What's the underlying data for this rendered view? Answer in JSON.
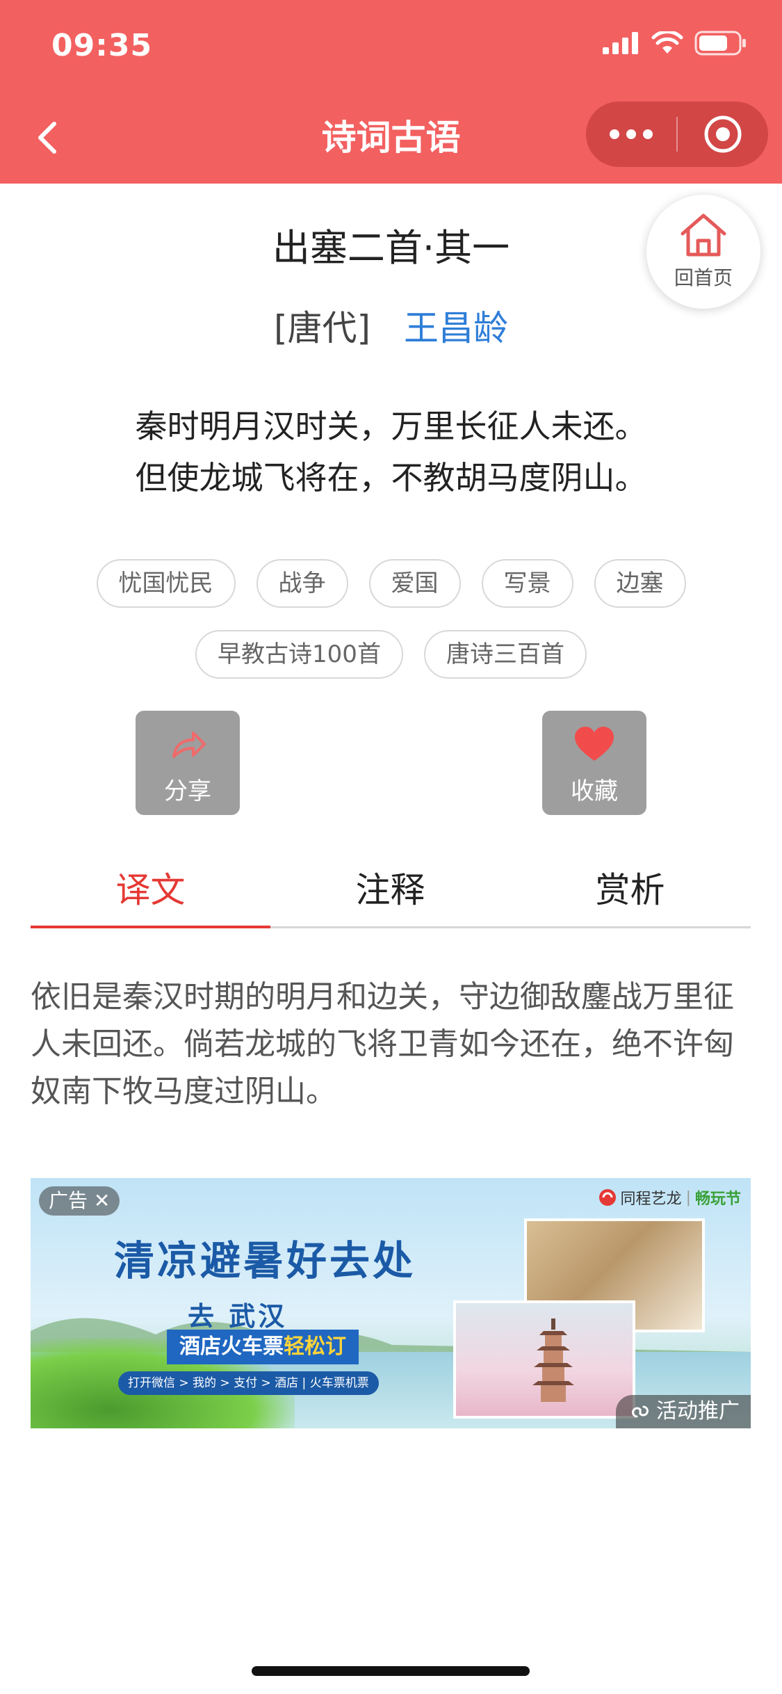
{
  "status_bar": {
    "time": "09:35"
  },
  "nav": {
    "title": "诗词古语"
  },
  "home_button": {
    "label": "回首页"
  },
  "poem": {
    "title": "出塞二首·其一",
    "dynasty": "[唐代]",
    "author": "王昌龄",
    "lines": [
      "秦时明月汉时关，万里长征人未还。",
      "但使龙城飞将在，不教胡马度阴山。"
    ]
  },
  "tags": {
    "row1": [
      "忧国忧民",
      "战争",
      "爱国",
      "写景",
      "边塞"
    ],
    "row2": [
      "早教古诗100首",
      "唐诗三百首"
    ]
  },
  "actions": {
    "share_label": "分享",
    "favorite_label": "收藏"
  },
  "tabs": [
    {
      "label": "译文",
      "active": true
    },
    {
      "label": "注释",
      "active": false
    },
    {
      "label": "赏析",
      "active": false
    }
  ],
  "translation": "依旧是秦汉时期的明月和边关，守边御敌鏖战万里征人未回还。倘若龙城的飞将卫青如今还在，绝不许匈奴南下牧马度过阴山。",
  "ad": {
    "badge": "广告",
    "brand": "同程艺龙",
    "brand_slogan": "畅玩节",
    "headline": "清凉避暑好去处",
    "sub": "去 武汉",
    "ribbon_prefix": "酒店火车票",
    "ribbon_highlight": "轻松订",
    "steps": "打开微信 > 我的 > 支付 > 酒店 | 火车票机票",
    "promo_label": "活动推广"
  },
  "colors": {
    "header": "#f36060",
    "accent_red": "#e53935",
    "author_blue": "#2f7ed8",
    "action_gray": "#9e9e9e"
  }
}
